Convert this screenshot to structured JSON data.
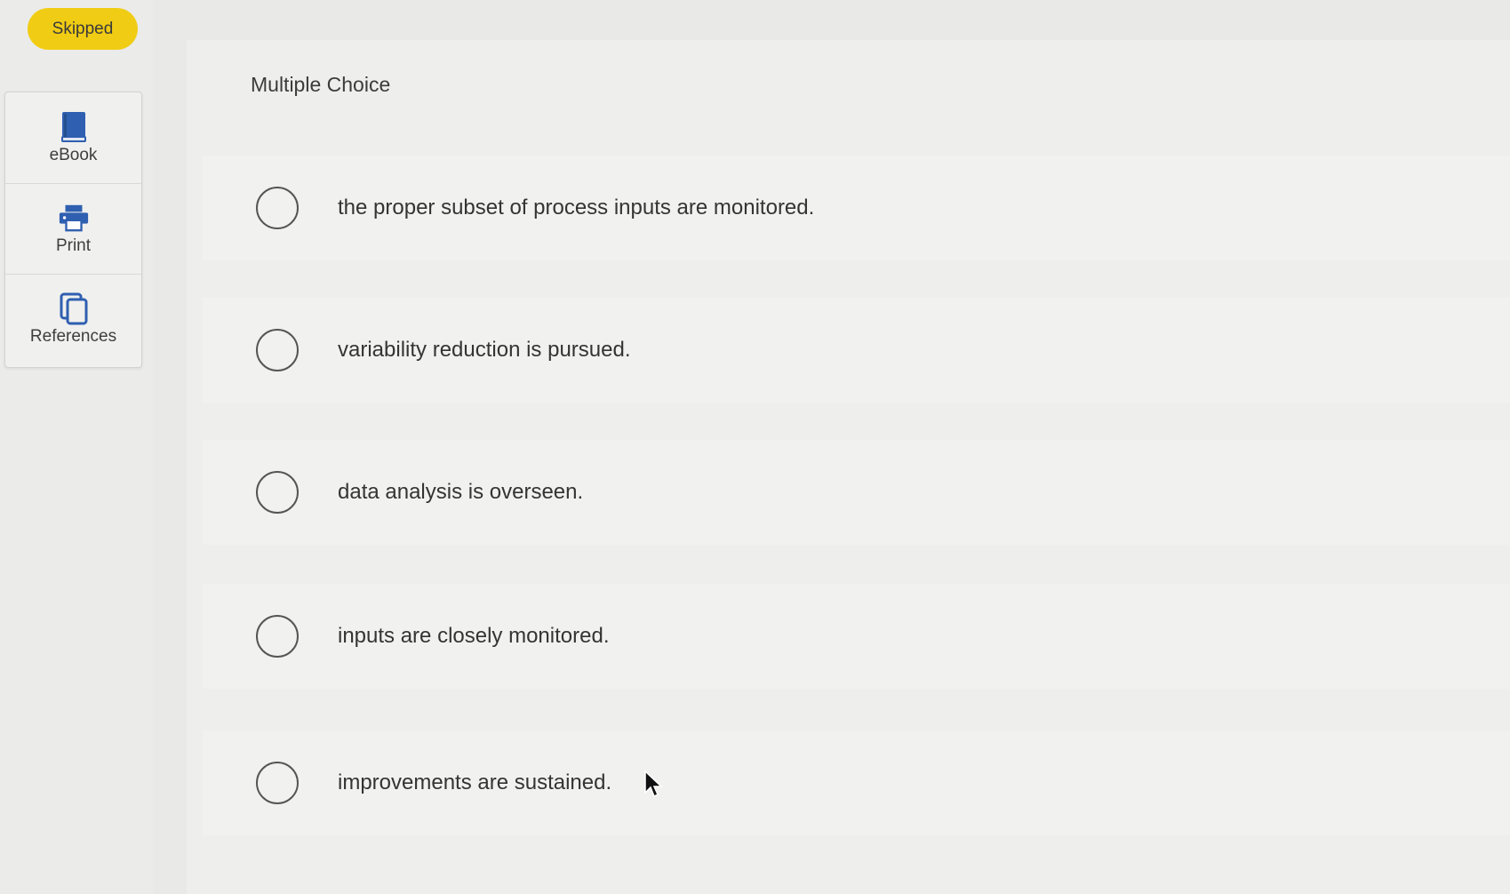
{
  "status": {
    "label": "Skipped",
    "color": "#f0cc14"
  },
  "tools": [
    {
      "label": "eBook",
      "icon": "book-icon"
    },
    {
      "label": "Print",
      "icon": "printer-icon"
    },
    {
      "label": "References",
      "icon": "copy-icon"
    }
  ],
  "question": {
    "type_label": "Multiple Choice",
    "choices": [
      {
        "text": "the proper subset of process inputs are monitored.",
        "selected": false
      },
      {
        "text": "variability reduction is pursued.",
        "selected": false
      },
      {
        "text": "data analysis is overseen.",
        "selected": false
      },
      {
        "text": "inputs are closely monitored.",
        "selected": false
      },
      {
        "text": "improvements are sustained.",
        "selected": false
      }
    ]
  },
  "colors": {
    "accent_icon": "#2f5fb0",
    "badge": "#f0cc14"
  }
}
